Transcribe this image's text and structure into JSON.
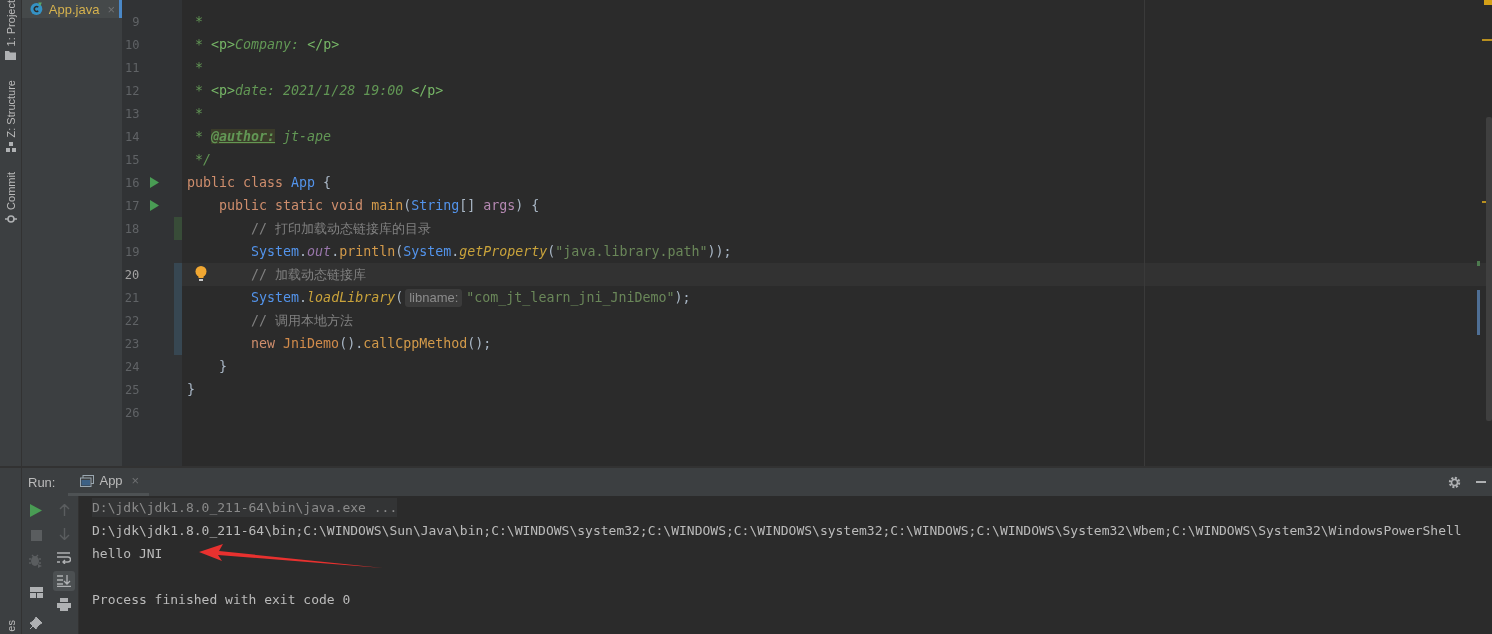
{
  "tool_strip": {
    "items": [
      {
        "kind": "project",
        "label": "1: Project"
      },
      {
        "kind": "structure",
        "label": "Z: Structure"
      },
      {
        "kind": "commit",
        "label": "Commit"
      }
    ],
    "bottom_label": "es"
  },
  "editor_tabs": [
    {
      "label": "App.java",
      "selected": true,
      "close": "×"
    }
  ],
  "editor": {
    "lines": [
      {
        "number": "9",
        "current": false,
        "run_icon": false,
        "intention": false,
        "tokens": [
          {
            "kind": "doc",
            "text": " *"
          }
        ]
      },
      {
        "number": "10",
        "current": false,
        "run_icon": false,
        "intention": false,
        "tokens": [
          {
            "kind": "doc",
            "text": " * "
          },
          {
            "kind": "doc-tag",
            "text": "<p>"
          },
          {
            "kind": "doc",
            "text": "Company: "
          },
          {
            "kind": "doc-tag",
            "text": "</p>"
          }
        ]
      },
      {
        "number": "11",
        "current": false,
        "run_icon": false,
        "intention": false,
        "tokens": [
          {
            "kind": "doc",
            "text": " *"
          }
        ]
      },
      {
        "number": "12",
        "current": false,
        "run_icon": false,
        "intention": false,
        "tokens": [
          {
            "kind": "doc",
            "text": " * "
          },
          {
            "kind": "doc-tag",
            "text": "<p>"
          },
          {
            "kind": "doc",
            "text": "date: 2021/1/28 19:00 "
          },
          {
            "kind": "doc-tag",
            "text": "</p>"
          }
        ]
      },
      {
        "number": "13",
        "current": false,
        "run_icon": false,
        "intention": false,
        "tokens": [
          {
            "kind": "doc",
            "text": " *"
          }
        ]
      },
      {
        "number": "14",
        "current": false,
        "run_icon": false,
        "intention": false,
        "tokens": [
          {
            "kind": "doc",
            "text": " * "
          },
          {
            "kind": "doc-author",
            "text": "@author:"
          },
          {
            "kind": "doc",
            "text": " jt-ape"
          }
        ]
      },
      {
        "number": "15",
        "current": false,
        "run_icon": false,
        "intention": false,
        "tokens": [
          {
            "kind": "doc",
            "text": " */"
          }
        ]
      },
      {
        "number": "16",
        "current": false,
        "run_icon": true,
        "intention": false,
        "tokens": [
          {
            "kind": "keyword",
            "text": "public class "
          },
          {
            "kind": "type",
            "text": "App"
          },
          {
            "kind": "plain",
            "text": " {"
          }
        ]
      },
      {
        "number": "17",
        "current": false,
        "run_icon": true,
        "intention": false,
        "tokens": [
          {
            "kind": "keyword",
            "text": "    public static void "
          },
          {
            "kind": "method",
            "text": "main"
          },
          {
            "kind": "plain",
            "text": "("
          },
          {
            "kind": "type",
            "text": "String"
          },
          {
            "kind": "plain",
            "text": "[] "
          },
          {
            "kind": "param",
            "text": "args"
          },
          {
            "kind": "plain",
            "text": ") {"
          }
        ]
      },
      {
        "number": "18",
        "current": false,
        "run_icon": false,
        "intention": false,
        "color": "#384c38",
        "tokens": [
          {
            "kind": "comment",
            "text": "        // 打印加载动态链接库的目录"
          }
        ]
      },
      {
        "number": "19",
        "current": false,
        "run_icon": false,
        "intention": false,
        "tokens": [
          {
            "kind": "type",
            "text": "        System"
          },
          {
            "kind": "plain",
            "text": "."
          },
          {
            "kind": "field",
            "text": "out"
          },
          {
            "kind": "plain",
            "text": "."
          },
          {
            "kind": "method",
            "text": "println"
          },
          {
            "kind": "plain",
            "text": "("
          },
          {
            "kind": "type",
            "text": "System"
          },
          {
            "kind": "plain",
            "text": "."
          },
          {
            "kind": "static-method",
            "text": "getProperty"
          },
          {
            "kind": "plain",
            "text": "("
          },
          {
            "kind": "string",
            "text": "\"java.library.path\""
          },
          {
            "kind": "plain",
            "text": "));"
          }
        ]
      },
      {
        "number": "20",
        "current": true,
        "run_icon": false,
        "intention": true,
        "color": "#374752",
        "tokens": [
          {
            "kind": "comment",
            "text": "        // 加载动态链接库"
          }
        ]
      },
      {
        "number": "21",
        "current": false,
        "run_icon": false,
        "intention": false,
        "color": "#374752",
        "tokens": [
          {
            "kind": "type",
            "text": "        System"
          },
          {
            "kind": "plain",
            "text": "."
          },
          {
            "kind": "static-method",
            "text": "loadLibrary"
          },
          {
            "kind": "plain",
            "text": "("
          },
          {
            "kind": "hint",
            "text": "libname:"
          },
          {
            "kind": "string",
            "text": "\"com_jt_learn_jni_JniDemo\""
          },
          {
            "kind": "plain",
            "text": ");"
          }
        ]
      },
      {
        "number": "22",
        "current": false,
        "run_icon": false,
        "intention": false,
        "color": "#374752",
        "tokens": [
          {
            "kind": "comment",
            "text": "        // 调用本地方法"
          }
        ]
      },
      {
        "number": "23",
        "current": false,
        "run_icon": false,
        "intention": false,
        "color": "#374752",
        "tokens": [
          {
            "kind": "keyword",
            "text": "        new "
          },
          {
            "kind": "class-ref",
            "text": "JniDemo"
          },
          {
            "kind": "plain",
            "text": "()."
          },
          {
            "kind": "method",
            "text": "callCppMethod"
          },
          {
            "kind": "plain",
            "text": "();"
          }
        ]
      },
      {
        "number": "24",
        "current": false,
        "run_icon": false,
        "intention": false,
        "tokens": [
          {
            "kind": "plain",
            "text": "    }"
          }
        ]
      },
      {
        "number": "25",
        "current": false,
        "run_icon": false,
        "intention": false,
        "tokens": [
          {
            "kind": "plain",
            "text": "}"
          }
        ]
      },
      {
        "number": "26",
        "current": false,
        "run_icon": false,
        "intention": false
      }
    ]
  },
  "run_panel": {
    "title": "Run:",
    "tabs": [
      {
        "label": "App",
        "selected": true,
        "close": "×"
      }
    ],
    "console": [
      {
        "kind": "command",
        "text": "D:\\jdk\\jdk1.8.0_211-64\\bin\\java.exe ..."
      },
      {
        "kind": "output",
        "text": "D:\\jdk\\jdk1.8.0_211-64\\bin;C:\\WINDOWS\\Sun\\Java\\bin;C:\\WINDOWS\\system32;C:\\WINDOWS;C:\\WINDOWS\\system32;C:\\WINDOWS;C:\\WINDOWS\\System32\\Wbem;C:\\WINDOWS\\System32\\WindowsPowerShell"
      },
      {
        "kind": "output",
        "text": "hello JNI"
      },
      {
        "kind": "status",
        "text": "Process finished with exit code 0"
      }
    ]
  }
}
